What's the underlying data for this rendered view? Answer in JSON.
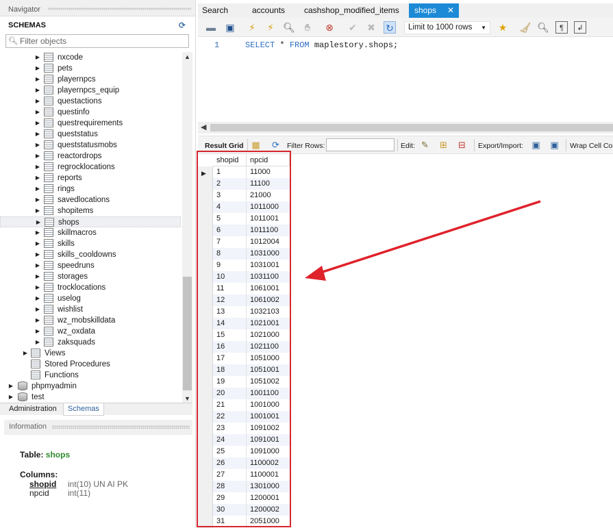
{
  "navigator": {
    "title": "Navigator",
    "schemas_label": "SCHEMAS",
    "filter_placeholder": "Filter objects",
    "tables": [
      "nxcode",
      "pets",
      "playernpcs",
      "playernpcs_equip",
      "questactions",
      "questinfo",
      "questrequirements",
      "queststatus",
      "queststatusmobs",
      "reactordrops",
      "regrocklocations",
      "reports",
      "rings",
      "savedlocations",
      "shopitems",
      "shops",
      "skillmacros",
      "skills",
      "skills_cooldowns",
      "speedruns",
      "storages",
      "trocklocations",
      "uselog",
      "wishlist",
      "wz_mobskilldata",
      "wz_oxdata",
      "zaksquads"
    ],
    "selected_table": "shops",
    "folders": [
      "Views",
      "Stored Procedures",
      "Functions"
    ],
    "databases": [
      "phpmyadmin",
      "test"
    ],
    "tabs": [
      "Administration",
      "Schemas"
    ],
    "active_tab": "Schemas"
  },
  "information": {
    "title": "Information",
    "table_label": "Table:",
    "table_name": "shops",
    "columns_label": "Columns:",
    "columns": [
      {
        "name": "shopid",
        "type": "int(10) UN AI PK"
      },
      {
        "name": "npcid",
        "type": "int(11)"
      }
    ]
  },
  "query_tabs": [
    {
      "label": "Search"
    },
    {
      "label": "accounts"
    },
    {
      "label": "cashshop_modified_items"
    },
    {
      "label": "shops",
      "active": true
    }
  ],
  "toolbar": {
    "limit_label": "Limit to 1000 rows"
  },
  "editor": {
    "line_number": "1",
    "kw_select": "SELECT",
    "star": " * ",
    "kw_from": "FROM",
    "target": " maplestory.shops;"
  },
  "result_bar": {
    "result_grid": "Result Grid",
    "filter_rows": "Filter Rows:",
    "edit": "Edit:",
    "export_import": "Export/Import:",
    "wrap": "Wrap Cell Co"
  },
  "grid": {
    "columns": [
      "shopid",
      "npcid"
    ],
    "rows": [
      [
        "1",
        "11000"
      ],
      [
        "2",
        "11100"
      ],
      [
        "3",
        "21000"
      ],
      [
        "4",
        "1011000"
      ],
      [
        "5",
        "1011001"
      ],
      [
        "6",
        "1011100"
      ],
      [
        "7",
        "1012004"
      ],
      [
        "8",
        "1031000"
      ],
      [
        "9",
        "1031001"
      ],
      [
        "10",
        "1031100"
      ],
      [
        "11",
        "1061001"
      ],
      [
        "12",
        "1061002"
      ],
      [
        "13",
        "1032103"
      ],
      [
        "14",
        "1021001"
      ],
      [
        "15",
        "1021000"
      ],
      [
        "16",
        "1021100"
      ],
      [
        "17",
        "1051000"
      ],
      [
        "18",
        "1051001"
      ],
      [
        "19",
        "1051002"
      ],
      [
        "20",
        "1001100"
      ],
      [
        "21",
        "1001000"
      ],
      [
        "22",
        "1001001"
      ],
      [
        "23",
        "1091002"
      ],
      [
        "24",
        "1091001"
      ],
      [
        "25",
        "1091000"
      ],
      [
        "26",
        "1100002"
      ],
      [
        "27",
        "1100001"
      ],
      [
        "28",
        "1301000"
      ],
      [
        "29",
        "1200001"
      ],
      [
        "30",
        "1200002"
      ],
      [
        "31",
        "2051000"
      ]
    ]
  },
  "colors": {
    "active_tab": "#1c8ad6",
    "highlight_box": "#d6262d",
    "table_name": "#2e8b2e"
  }
}
